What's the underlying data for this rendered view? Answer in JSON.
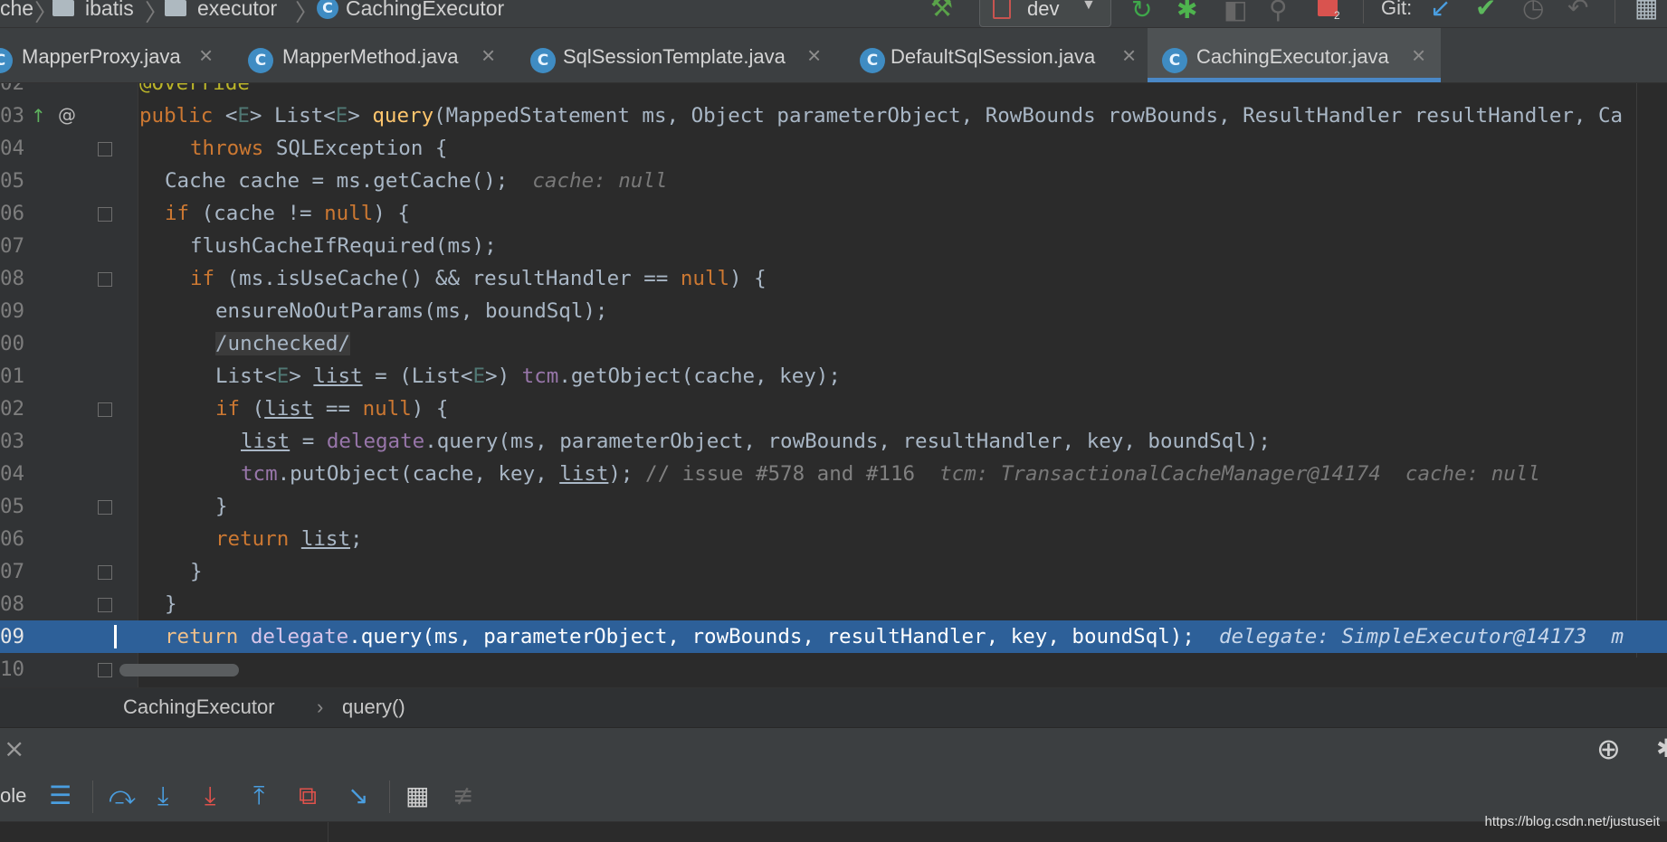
{
  "breadcrumb_top": {
    "items": [
      "che",
      "ibatis",
      "executor",
      "CachingExecutor"
    ]
  },
  "toolbar": {
    "branch": "dev",
    "git_label": "Git:",
    "badge_count": "2"
  },
  "tabs": [
    {
      "label": "MapperProxy.java",
      "active": false
    },
    {
      "label": "MapperMethod.java",
      "active": false
    },
    {
      "label": "SqlSessionTemplate.java",
      "active": false
    },
    {
      "label": "DefaultSqlSession.java",
      "active": false
    },
    {
      "label": "CachingExecutor.java",
      "active": true
    }
  ],
  "editor": {
    "line_numbers": [
      "02",
      "03",
      "04",
      "05",
      "06",
      "07",
      "08",
      "09",
      "00",
      "01",
      "02",
      "03",
      "04",
      "05",
      "06",
      "07",
      "08",
      "09",
      "10"
    ],
    "lines": {
      "l02_ann": "@Override",
      "l03_a": "public ",
      "l03_b": "<",
      "l03_c": "E",
      "l03_d": "> List<",
      "l03_e": "E",
      "l03_f": "> ",
      "l03_g": "query",
      "l03_h": "(MappedStatement ms, Object parameterObject, RowBounds rowBounds, ResultHandler resultHandler, Ca",
      "l04_kw": "throws ",
      "l04_rest": "SQLException {",
      "l05_code": "Cache cache = ms.getCache();",
      "l05_inline": "cache: null",
      "l06_kw": "if ",
      "l06_rest": "(cache != ",
      "l06_null": "null",
      "l06_end": ") {",
      "l07": "flushCacheIfRequired(ms);",
      "l08_kw": "if ",
      "l08_rest": "(ms.isUseCache() && resultHandler == ",
      "l08_null": "null",
      "l08_end": ") {",
      "l09": "ensureNoOutParams(ms, boundSql);",
      "l10": "/unchecked/",
      "l11_a": "List<",
      "l11_b": "E",
      "l11_c": "> ",
      "l11_d": "list",
      "l11_e": " = (List<",
      "l11_f": "E",
      "l11_g": ">) ",
      "l11_h": "tcm",
      "l11_i": ".getObject(cache, key);",
      "l12_kw": "if ",
      "l12_a": "(",
      "l12_b": "list",
      "l12_c": " == ",
      "l12_null": "null",
      "l12_end": ") {",
      "l13_a": "list",
      "l13_b": " = ",
      "l13_c": "delegate",
      "l13_d": ".query(ms, parameterObject, rowBounds, resultHandler, key, boundSql);",
      "l14_a": "tcm",
      "l14_b": ".putObject(cache, key, ",
      "l14_c": "list",
      "l14_d": "); ",
      "l14_cmt": "// issue #578 and #116",
      "l14_inline": "tcm: TransactionalCacheManager@14174  cache: null",
      "l15": "}",
      "l16_kw": "return ",
      "l16_a": "list",
      "l16_b": ";",
      "l17": "}",
      "l18": "}",
      "l19_kw": "return ",
      "l19_a": "delegate",
      "l19_b": ".query(ms, parameterObject, rowBounds, resultHandler, key, boundSql);",
      "l19_inline": "delegate: SimpleExecutor@14173  m"
    }
  },
  "structure_crumbs": {
    "class_name": "CachingExecutor",
    "chevron": "›",
    "method": "query()"
  },
  "debug": {
    "console_label": "ole",
    "watermark": "https://blog.csdn.net/justuseit"
  }
}
